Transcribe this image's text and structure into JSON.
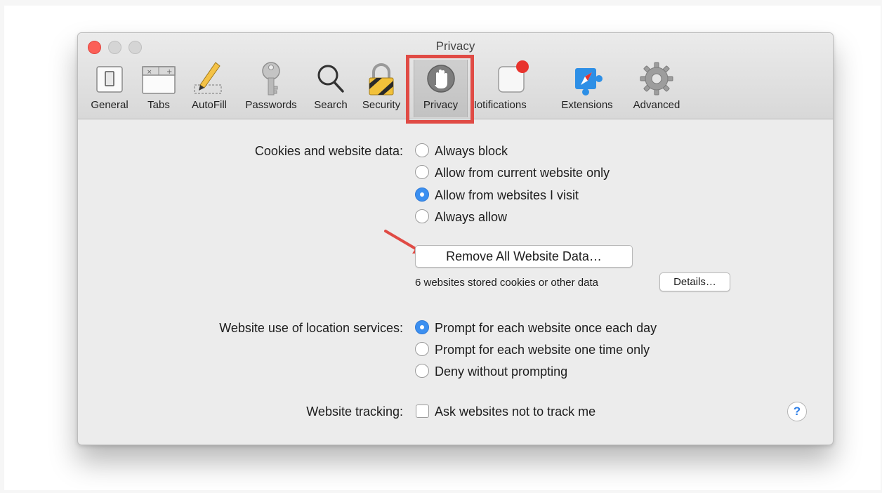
{
  "window": {
    "title": "Privacy"
  },
  "toolbar": [
    {
      "label": "General",
      "icon": "general-switch-icon"
    },
    {
      "label": "Tabs",
      "icon": "tabs-icon"
    },
    {
      "label": "AutoFill",
      "icon": "pencil-icon"
    },
    {
      "label": "Passwords",
      "icon": "key-icon"
    },
    {
      "label": "Search",
      "icon": "magnifier-icon"
    },
    {
      "label": "Security",
      "icon": "padlock-icon"
    },
    {
      "label": "Privacy",
      "icon": "hand-icon",
      "selected": true
    },
    {
      "label": "Notifications",
      "icon": "notification-icon"
    },
    {
      "label": "Extensions",
      "icon": "puzzle-icon"
    },
    {
      "label": "Advanced",
      "icon": "gear-icon"
    }
  ],
  "cookies": {
    "label": "Cookies and website data:",
    "options": [
      "Always block",
      "Allow from current website only",
      "Allow from websites I visit",
      "Always allow"
    ],
    "selected": "Allow from websites I visit"
  },
  "remove_button": "Remove All Website Data…",
  "stored_info": "6 websites stored cookies or other data",
  "details_button": "Details…",
  "location": {
    "label": "Website use of location services:",
    "options": [
      "Prompt for each website once each day",
      "Prompt for each website one time only",
      "Deny without prompting"
    ],
    "selected": "Prompt for each website once each day"
  },
  "tracking": {
    "label": "Website tracking:",
    "checkbox_label": "Ask websites not to track me",
    "checked": false
  },
  "help_button": "?",
  "colors": {
    "highlight": "#e04b45",
    "radio_selected": "#3b8ff0",
    "close": "#fb5f57"
  }
}
